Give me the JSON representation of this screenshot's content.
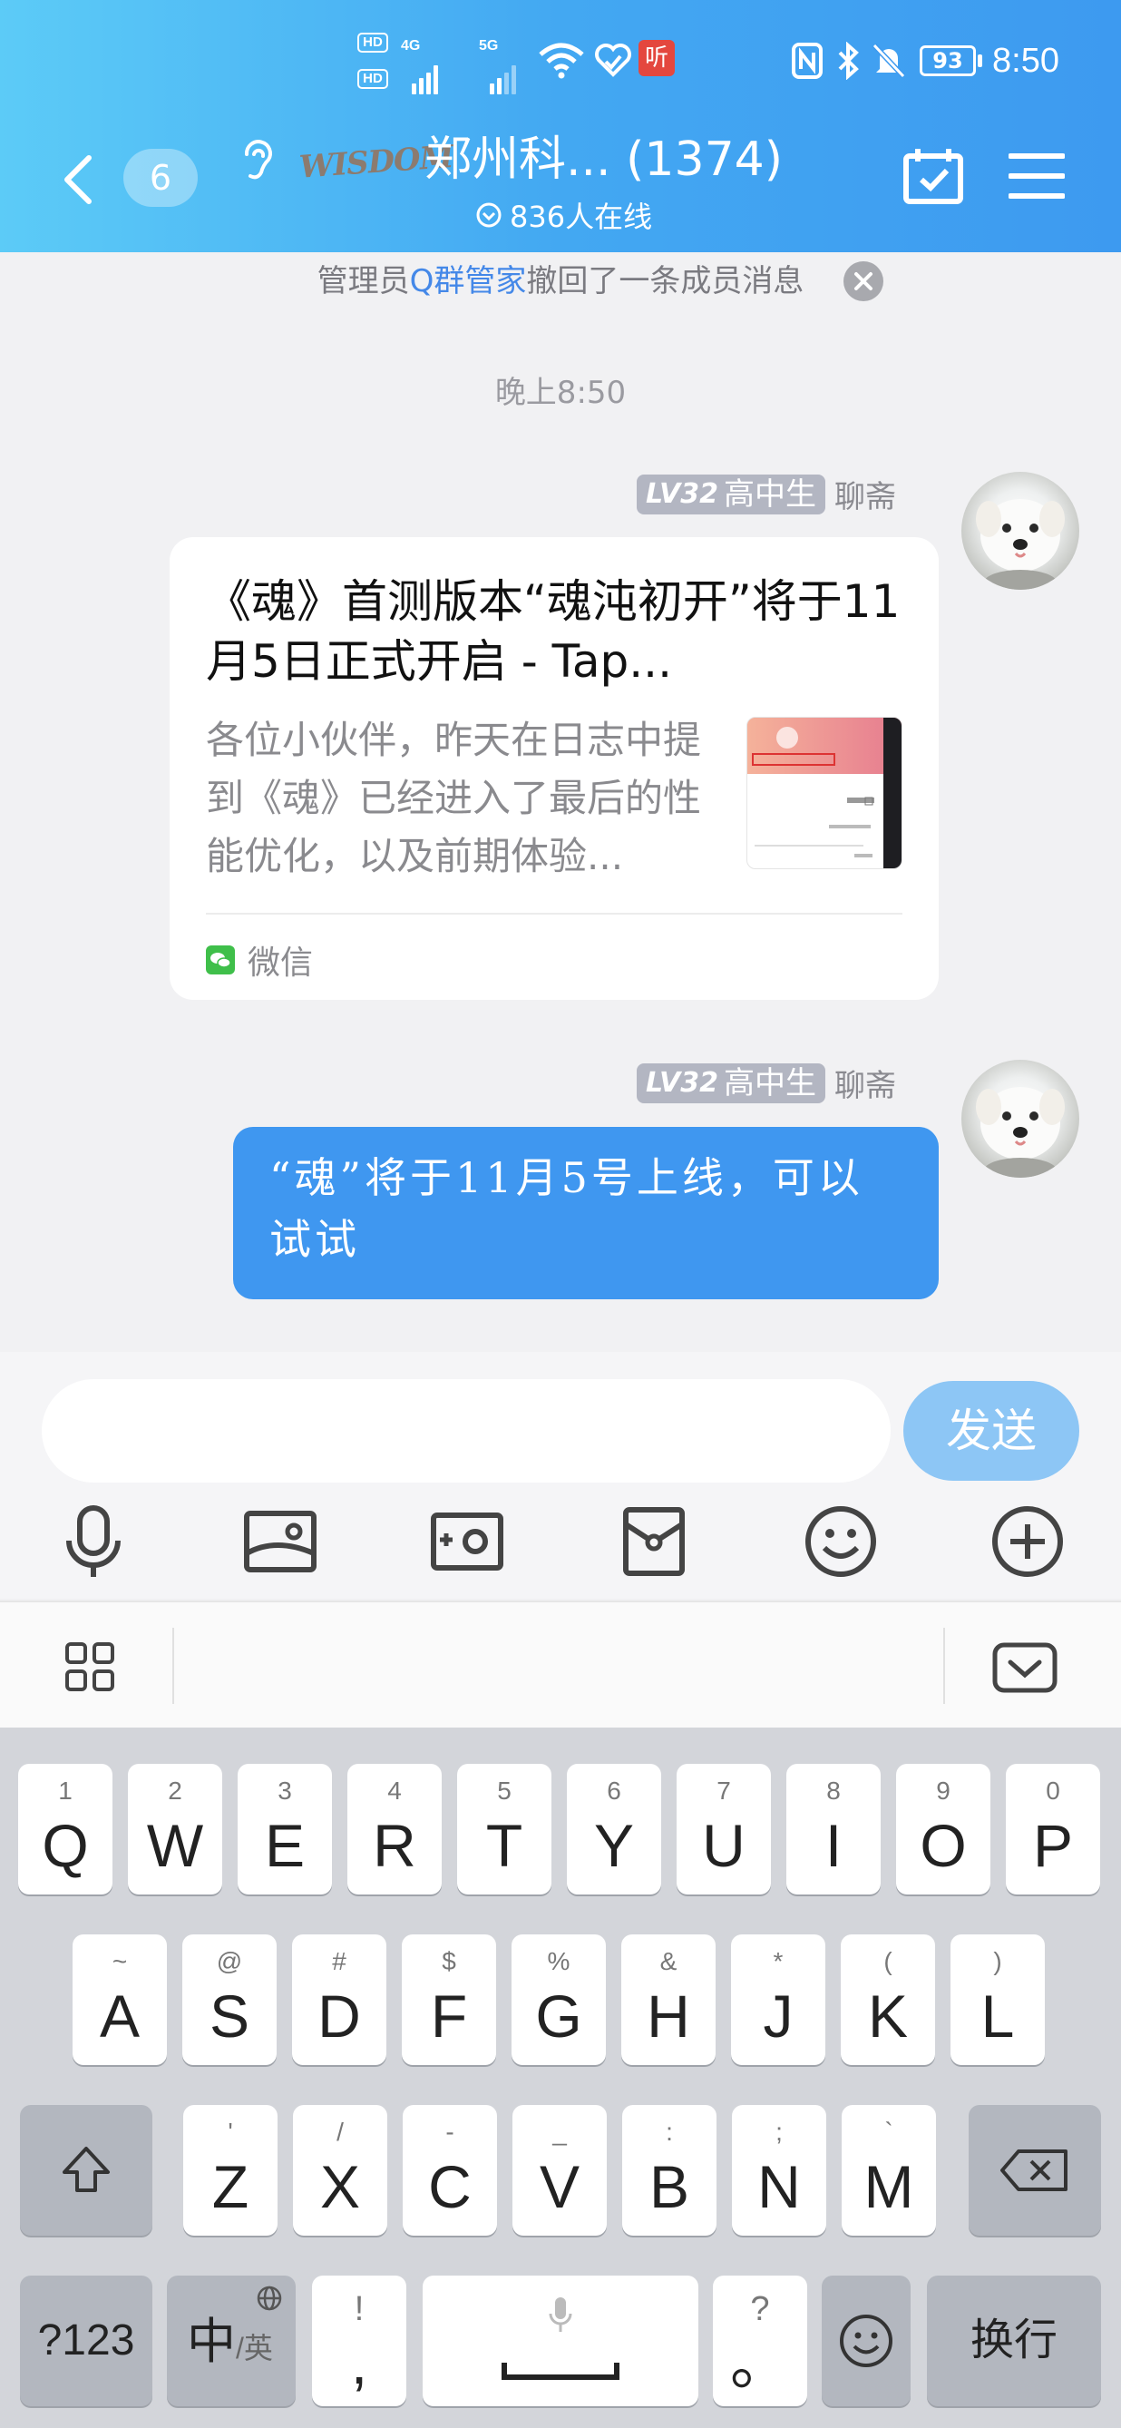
{
  "status_bar": {
    "hd1": "HD",
    "hd2": "HD",
    "net1": "4G",
    "net2": "5G",
    "battery": "93",
    "time": "8:50"
  },
  "header": {
    "back_count": "6",
    "group_title": "郑州科... (1374)",
    "logo_text": "WISDOM",
    "online": "836人在线"
  },
  "notice": {
    "prefix": "管理员",
    "highlight": "Q群管家",
    "suffix": "撤回了一条成员消息"
  },
  "timestamp": "晚上8:50",
  "messages": [
    {
      "level": "LV32",
      "title": "高中生",
      "sender": "聊斋",
      "card": {
        "title": "《魂》首测版本“魂沌初开”将于11月5日正式开启 - Tap...",
        "desc": "各位小伙伴，昨天在日志中提到《魂》已经进入了最后的性能优化，以及前期体验...",
        "source": "微信"
      }
    },
    {
      "level": "LV32",
      "title": "高中生",
      "sender": "聊斋",
      "text": "“魂”将于11月5号上线，可以试试"
    }
  ],
  "input": {
    "placeholder": "",
    "send_label": "发送"
  },
  "toolbar_icons": [
    "microphone-icon",
    "image-icon",
    "camera-icon",
    "red-packet-icon",
    "emoji-icon",
    "plus-icon"
  ],
  "keyboard": {
    "row1": [
      {
        "sub": "1",
        "main": "Q"
      },
      {
        "sub": "2",
        "main": "W"
      },
      {
        "sub": "3",
        "main": "E"
      },
      {
        "sub": "4",
        "main": "R"
      },
      {
        "sub": "5",
        "main": "T"
      },
      {
        "sub": "6",
        "main": "Y"
      },
      {
        "sub": "7",
        "main": "U"
      },
      {
        "sub": "8",
        "main": "I"
      },
      {
        "sub": "9",
        "main": "O"
      },
      {
        "sub": "0",
        "main": "P"
      }
    ],
    "row2": [
      {
        "sub": "~",
        "main": "A"
      },
      {
        "sub": "@",
        "main": "S"
      },
      {
        "sub": "#",
        "main": "D"
      },
      {
        "sub": "$",
        "main": "F"
      },
      {
        "sub": "%",
        "main": "G"
      },
      {
        "sub": "&",
        "main": "H"
      },
      {
        "sub": "*",
        "main": "J"
      },
      {
        "sub": "(",
        "main": "K"
      },
      {
        "sub": ")",
        "main": "L"
      }
    ],
    "row3": [
      {
        "sub": "'",
        "main": "Z"
      },
      {
        "sub": "/",
        "main": "X"
      },
      {
        "sub": "-",
        "main": "C"
      },
      {
        "sub": "_",
        "main": "V"
      },
      {
        "sub": ":",
        "main": "B"
      },
      {
        "sub": ";",
        "main": "N"
      },
      {
        "sub": "`",
        "main": "M"
      }
    ],
    "sym_key": "?123",
    "lang_main": "中",
    "lang_sub": "/英",
    "comma_sub": "!",
    "comma_main": ",",
    "period_sub": "?",
    "period_main": "。",
    "enter_key": "换行"
  }
}
